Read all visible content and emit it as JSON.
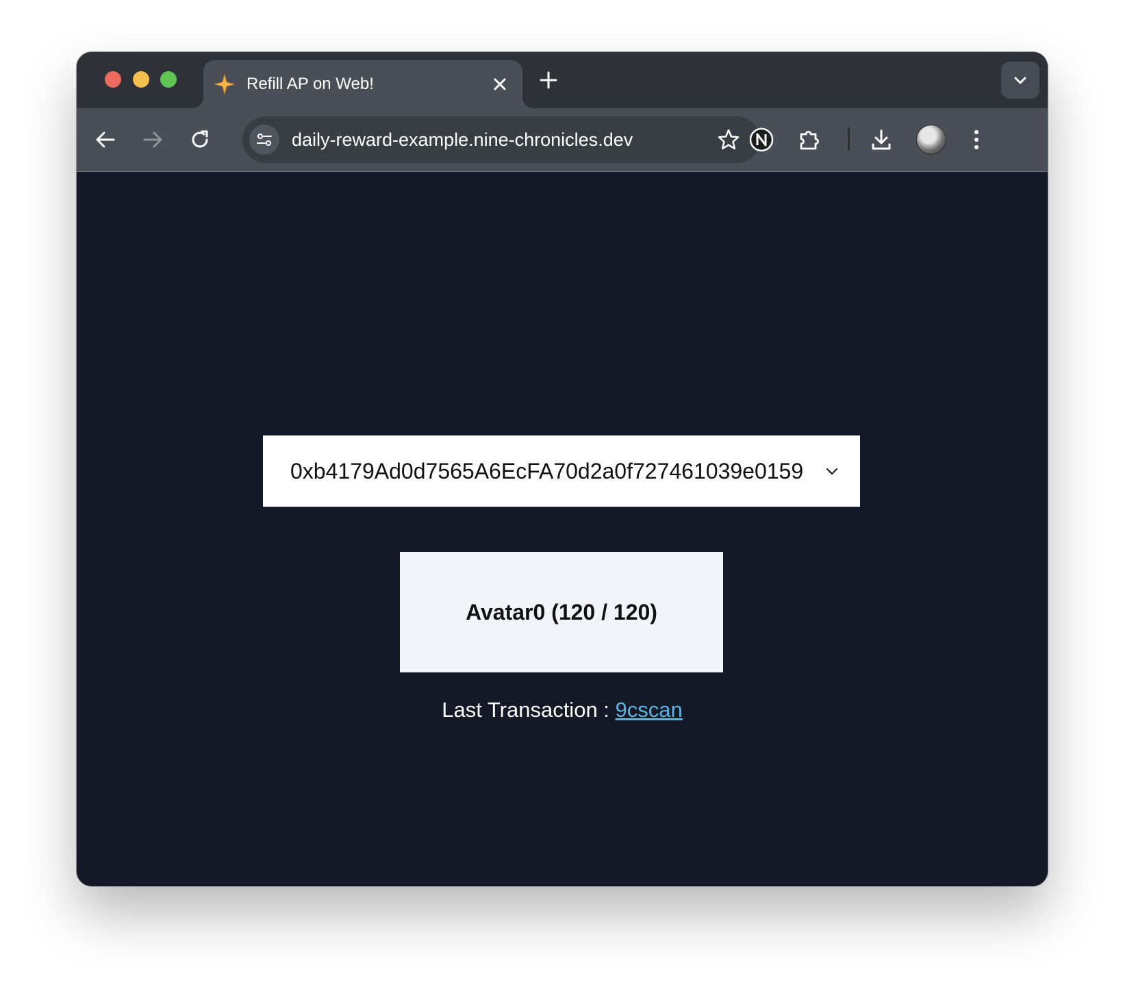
{
  "browser": {
    "tab": {
      "title": "Refill AP on Web!",
      "favicon": "sparkle-icon"
    },
    "url": "daily-reward-example.nine-chronicles.dev",
    "extensions": [
      "nine-chronicles-extension-icon",
      "puzzle-extension-icon"
    ],
    "accent": "#f4bf4f"
  },
  "page": {
    "address_select": {
      "value": "0xb4179Ad0d7565A6EcFA70d2a0f727461039e0159"
    },
    "avatar_button": {
      "label": "Avatar0 (120 / 120)"
    },
    "last_transaction": {
      "label": "Last Transaction : ",
      "link_text": "9cscan"
    },
    "colors": {
      "background": "#131927",
      "link": "#5bb4dd",
      "button_bg": "#f1f4f9"
    }
  }
}
